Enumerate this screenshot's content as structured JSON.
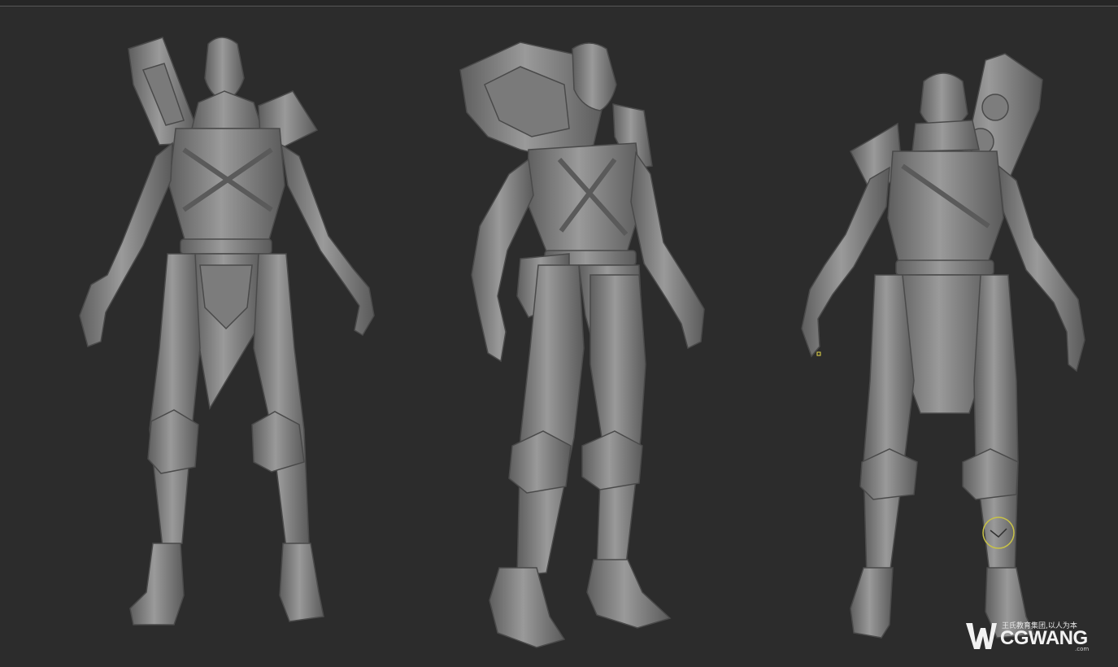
{
  "canvas": {
    "background": "#2c2c2c",
    "model_color": "#8a8a8a",
    "views": [
      "front",
      "three-quarter",
      "back"
    ]
  },
  "cursor": {
    "brush_ring_color": "#c8c247",
    "pivot_marker_color": "#e6d84a"
  },
  "watermark": {
    "tagline": "王氏教育集团,以人为本",
    "brand": "CGWANG",
    "domain": ".com",
    "logo_icon": "wcgwang-logo-icon"
  }
}
